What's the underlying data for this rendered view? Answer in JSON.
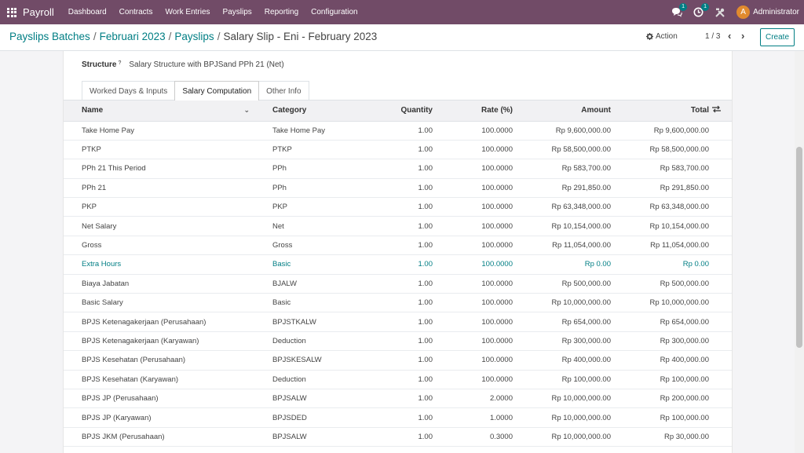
{
  "navbar": {
    "brand": "Payroll",
    "menu": [
      "Dashboard",
      "Contracts",
      "Work Entries",
      "Payslips",
      "Reporting",
      "Configuration"
    ],
    "chat_badge": "1",
    "activity_badge": "1",
    "avatar_letter": "A",
    "user": "Administrator"
  },
  "breadcrumb": {
    "items": [
      "Payslips Batches",
      "Februari 2023",
      "Payslips"
    ],
    "current": "Salary Slip - Eni - February 2023"
  },
  "toolbar": {
    "action_label": "Action",
    "pager": "1 / 3",
    "create_label": "Create"
  },
  "form": {
    "structure_label": "Structure",
    "structure_help": "?",
    "structure_value": "Salary Structure with BPJSand PPh 21 (Net)"
  },
  "tabs": [
    {
      "label": "Worked Days & Inputs",
      "active": false
    },
    {
      "label": "Salary Computation",
      "active": true
    },
    {
      "label": "Other Info",
      "active": false
    }
  ],
  "table": {
    "headers": {
      "name": "Name",
      "category": "Category",
      "quantity": "Quantity",
      "rate": "Rate (%)",
      "amount": "Amount",
      "total": "Total"
    },
    "rows": [
      {
        "name": "Take Home Pay",
        "category": "Take Home Pay",
        "quantity": "1.00",
        "rate": "100.0000",
        "amount": "Rp 9,600,000.00",
        "total": "Rp 9,600,000.00"
      },
      {
        "name": "PTKP",
        "category": "PTKP",
        "quantity": "1.00",
        "rate": "100.0000",
        "amount": "Rp 58,500,000.00",
        "total": "Rp 58,500,000.00"
      },
      {
        "name": "PPh 21 This Period",
        "category": "PPh",
        "quantity": "1.00",
        "rate": "100.0000",
        "amount": "Rp 583,700.00",
        "total": "Rp 583,700.00"
      },
      {
        "name": "PPh 21",
        "category": "PPh",
        "quantity": "1.00",
        "rate": "100.0000",
        "amount": "Rp 291,850.00",
        "total": "Rp 291,850.00"
      },
      {
        "name": "PKP",
        "category": "PKP",
        "quantity": "1.00",
        "rate": "100.0000",
        "amount": "Rp 63,348,000.00",
        "total": "Rp 63,348,000.00"
      },
      {
        "name": "Net Salary",
        "category": "Net",
        "quantity": "1.00",
        "rate": "100.0000",
        "amount": "Rp 10,154,000.00",
        "total": "Rp 10,154,000.00"
      },
      {
        "name": "Gross",
        "category": "Gross",
        "quantity": "1.00",
        "rate": "100.0000",
        "amount": "Rp 11,054,000.00",
        "total": "Rp 11,054,000.00"
      },
      {
        "name": "Extra Hours",
        "category": "Basic",
        "quantity": "1.00",
        "rate": "100.0000",
        "amount": "Rp 0.00",
        "total": "Rp 0.00",
        "highlight": true
      },
      {
        "name": "Biaya Jabatan",
        "category": "BJALW",
        "quantity": "1.00",
        "rate": "100.0000",
        "amount": "Rp 500,000.00",
        "total": "Rp 500,000.00"
      },
      {
        "name": "Basic Salary",
        "category": "Basic",
        "quantity": "1.00",
        "rate": "100.0000",
        "amount": "Rp 10,000,000.00",
        "total": "Rp 10,000,000.00"
      },
      {
        "name": "BPJS Ketenagakerjaan (Perusahaan)",
        "category": "BPJSTKALW",
        "quantity": "1.00",
        "rate": "100.0000",
        "amount": "Rp 654,000.00",
        "total": "Rp 654,000.00"
      },
      {
        "name": "BPJS Ketenagakerjaan (Karyawan)",
        "category": "Deduction",
        "quantity": "1.00",
        "rate": "100.0000",
        "amount": "Rp 300,000.00",
        "total": "Rp 300,000.00"
      },
      {
        "name": "BPJS Kesehatan (Perusahaan)",
        "category": "BPJSKESALW",
        "quantity": "1.00",
        "rate": "100.0000",
        "amount": "Rp 400,000.00",
        "total": "Rp 400,000.00"
      },
      {
        "name": "BPJS Kesehatan (Karyawan)",
        "category": "Deduction",
        "quantity": "1.00",
        "rate": "100.0000",
        "amount": "Rp 100,000.00",
        "total": "Rp 100,000.00"
      },
      {
        "name": "BPJS JP (Perusahaan)",
        "category": "BPJSALW",
        "quantity": "1.00",
        "rate": "2.0000",
        "amount": "Rp 10,000,000.00",
        "total": "Rp 200,000.00"
      },
      {
        "name": "BPJS JP (Karyawan)",
        "category": "BPJSDED",
        "quantity": "1.00",
        "rate": "1.0000",
        "amount": "Rp 10,000,000.00",
        "total": "Rp 100,000.00"
      },
      {
        "name": "BPJS JKM (Perusahaan)",
        "category": "BPJSALW",
        "quantity": "1.00",
        "rate": "0.3000",
        "amount": "Rp 10,000,000.00",
        "total": "Rp 30,000.00"
      }
    ]
  },
  "colors": {
    "brand": "#714b67",
    "accent": "#017e84"
  }
}
